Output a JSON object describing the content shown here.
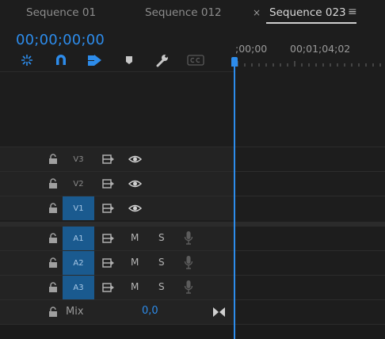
{
  "tabs": [
    {
      "label": "Sequence 01"
    },
    {
      "label": "Sequence 012"
    },
    {
      "label": "Sequence 023",
      "active": true
    }
  ],
  "tab_close_glyph": "×",
  "tab_menu_glyph": "≡",
  "timecode": "00;00;00;00",
  "tools": [
    "insert-sequence-nest-icon",
    "snap-magnet-icon",
    "linked-selection-icon",
    "add-marker-icon",
    "wrench-settings-icon",
    "captions-cc-icon"
  ],
  "ruler": {
    "start": ";00;00",
    "mark": "00;01;04;02"
  },
  "video_tracks": [
    {
      "label": "V3",
      "targeted": false
    },
    {
      "label": "V2",
      "targeted": false
    },
    {
      "label": "V1",
      "targeted": true
    }
  ],
  "audio_tracks": [
    {
      "label": "A1",
      "targeted": true,
      "mute": "M",
      "solo": "S"
    },
    {
      "label": "A2",
      "targeted": true,
      "mute": "M",
      "solo": "S"
    },
    {
      "label": "A3",
      "targeted": true,
      "mute": "M",
      "solo": "S"
    }
  ],
  "mix": {
    "label": "Mix",
    "value": "0,0"
  },
  "colors": {
    "accent": "#2d8ceb",
    "target_on": "#1a5a8f"
  }
}
